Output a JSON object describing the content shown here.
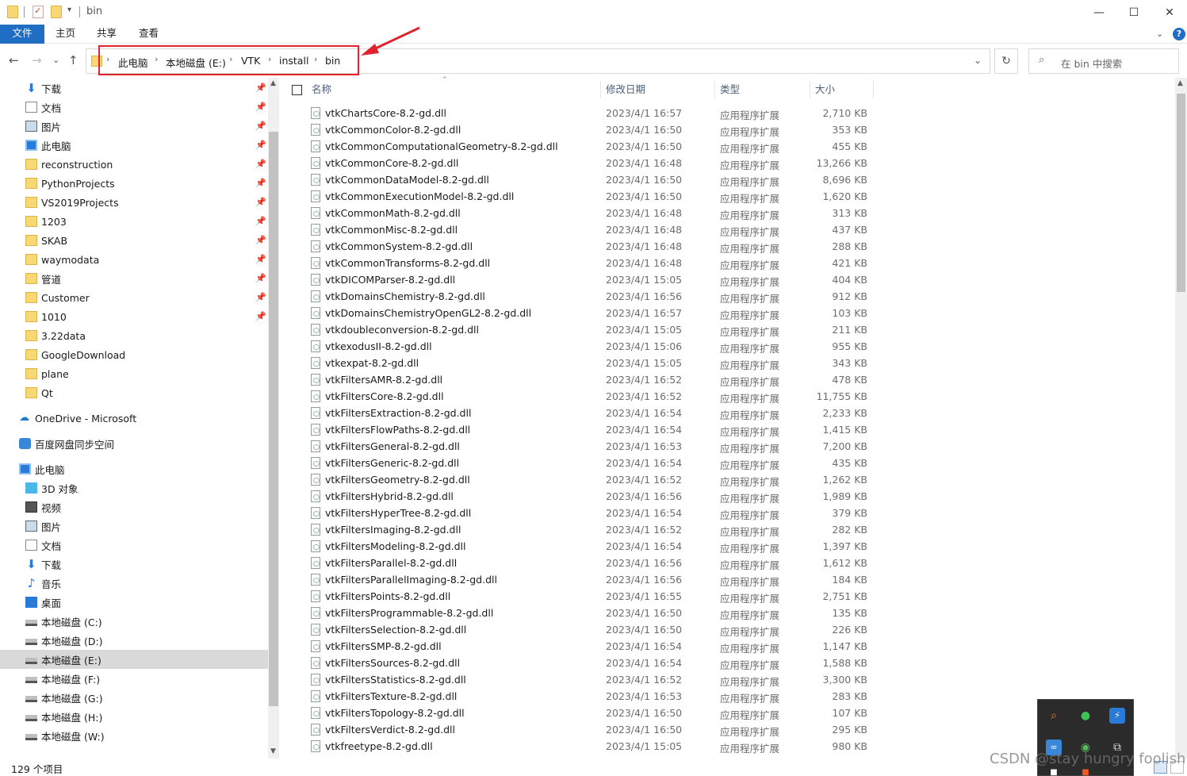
{
  "window": {
    "title": "bin",
    "minimize": "—",
    "maximize": "☐",
    "close": "✕"
  },
  "ribbon": {
    "tabs": [
      "文件",
      "主页",
      "共享",
      "查看"
    ],
    "expand": "⌄",
    "help": "?"
  },
  "nav": {
    "back": "←",
    "forward": "→",
    "recent": "⌄",
    "up": "↑",
    "breadcrumb": [
      "此电脑",
      "本地磁盘 (E:)",
      "VTK",
      "install",
      "bin"
    ],
    "refresh": "↻",
    "search_placeholder": "在 bin 中搜索"
  },
  "sidebar": {
    "quick_access": [
      {
        "label": "下载",
        "icon": "download-icon",
        "pinned": true
      },
      {
        "label": "文档",
        "icon": "document-icon",
        "pinned": true
      },
      {
        "label": "图片",
        "icon": "pictures-icon",
        "pinned": true
      },
      {
        "label": "此电脑",
        "icon": "computer-icon",
        "pinned": true
      },
      {
        "label": "reconstruction",
        "icon": "folder-icon",
        "pinned": true
      },
      {
        "label": "PythonProjects",
        "icon": "folder-icon",
        "pinned": true
      },
      {
        "label": "VS2019Projects",
        "icon": "folder-icon",
        "pinned": true
      },
      {
        "label": "1203",
        "icon": "folder-icon",
        "pinned": true
      },
      {
        "label": "SKAB",
        "icon": "folder-icon",
        "pinned": true
      },
      {
        "label": "waymodata",
        "icon": "folder-icon",
        "pinned": true
      },
      {
        "label": "管道",
        "icon": "folder-icon",
        "pinned": true
      },
      {
        "label": "Customer",
        "icon": "folder-icon",
        "pinned": true
      },
      {
        "label": "1010",
        "icon": "folder-icon",
        "pinned": true
      },
      {
        "label": "3.22data",
        "icon": "folder-icon",
        "pinned": false
      },
      {
        "label": "GoogleDownload",
        "icon": "folder-icon",
        "pinned": false
      },
      {
        "label": "plane",
        "icon": "folder-icon",
        "pinned": false
      },
      {
        "label": "Qt",
        "icon": "folder-icon",
        "pinned": false
      }
    ],
    "onedrive": "OneDrive - Microsoft",
    "baidu": "百度网盘同步空间",
    "this_pc": "此电脑",
    "pc_items": [
      {
        "label": "3D 对象",
        "icon": "3d-objects-icon"
      },
      {
        "label": "视频",
        "icon": "video-icon"
      },
      {
        "label": "图片",
        "icon": "pictures-icon"
      },
      {
        "label": "文档",
        "icon": "document-icon"
      },
      {
        "label": "下载",
        "icon": "download-icon"
      },
      {
        "label": "音乐",
        "icon": "music-icon"
      },
      {
        "label": "桌面",
        "icon": "desktop-icon"
      },
      {
        "label": "本地磁盘 (C:)",
        "icon": "system-drive-icon"
      },
      {
        "label": "本地磁盘 (D:)",
        "icon": "drive-icon"
      },
      {
        "label": "本地磁盘 (E:)",
        "icon": "drive-icon",
        "selected": true
      },
      {
        "label": "本地磁盘 (F:)",
        "icon": "drive-icon"
      },
      {
        "label": "本地磁盘 (G:)",
        "icon": "drive-icon"
      },
      {
        "label": "本地磁盘 (H:)",
        "icon": "drive-icon"
      },
      {
        "label": "本地磁盘 (W:)",
        "icon": "drive-icon"
      }
    ]
  },
  "columns": {
    "name": "名称",
    "date": "修改日期",
    "type": "类型",
    "size": "大小"
  },
  "files": [
    {
      "name": "vtkChartsCore-8.2-gd.dll",
      "date": "2023/4/1 16:57",
      "type": "应用程序扩展",
      "size": "2,710 KB"
    },
    {
      "name": "vtkCommonColor-8.2-gd.dll",
      "date": "2023/4/1 16:50",
      "type": "应用程序扩展",
      "size": "353 KB"
    },
    {
      "name": "vtkCommonComputationalGeometry-8.2-gd.dll",
      "date": "2023/4/1 16:50",
      "type": "应用程序扩展",
      "size": "455 KB"
    },
    {
      "name": "vtkCommonCore-8.2-gd.dll",
      "date": "2023/4/1 16:48",
      "type": "应用程序扩展",
      "size": "13,266 KB"
    },
    {
      "name": "vtkCommonDataModel-8.2-gd.dll",
      "date": "2023/4/1 16:50",
      "type": "应用程序扩展",
      "size": "8,696 KB"
    },
    {
      "name": "vtkCommonExecutionModel-8.2-gd.dll",
      "date": "2023/4/1 16:50",
      "type": "应用程序扩展",
      "size": "1,620 KB"
    },
    {
      "name": "vtkCommonMath-8.2-gd.dll",
      "date": "2023/4/1 16:48",
      "type": "应用程序扩展",
      "size": "313 KB"
    },
    {
      "name": "vtkCommonMisc-8.2-gd.dll",
      "date": "2023/4/1 16:48",
      "type": "应用程序扩展",
      "size": "437 KB"
    },
    {
      "name": "vtkCommonSystem-8.2-gd.dll",
      "date": "2023/4/1 16:48",
      "type": "应用程序扩展",
      "size": "288 KB"
    },
    {
      "name": "vtkCommonTransforms-8.2-gd.dll",
      "date": "2023/4/1 16:48",
      "type": "应用程序扩展",
      "size": "421 KB"
    },
    {
      "name": "vtkDICOMParser-8.2-gd.dll",
      "date": "2023/4/1 15:05",
      "type": "应用程序扩展",
      "size": "404 KB"
    },
    {
      "name": "vtkDomainsChemistry-8.2-gd.dll",
      "date": "2023/4/1 16:56",
      "type": "应用程序扩展",
      "size": "912 KB"
    },
    {
      "name": "vtkDomainsChemistryOpenGL2-8.2-gd.dll",
      "date": "2023/4/1 16:57",
      "type": "应用程序扩展",
      "size": "103 KB"
    },
    {
      "name": "vtkdoubleconversion-8.2-gd.dll",
      "date": "2023/4/1 15:05",
      "type": "应用程序扩展",
      "size": "211 KB"
    },
    {
      "name": "vtkexodusII-8.2-gd.dll",
      "date": "2023/4/1 15:06",
      "type": "应用程序扩展",
      "size": "955 KB"
    },
    {
      "name": "vtkexpat-8.2-gd.dll",
      "date": "2023/4/1 15:05",
      "type": "应用程序扩展",
      "size": "343 KB"
    },
    {
      "name": "vtkFiltersAMR-8.2-gd.dll",
      "date": "2023/4/1 16:52",
      "type": "应用程序扩展",
      "size": "478 KB"
    },
    {
      "name": "vtkFiltersCore-8.2-gd.dll",
      "date": "2023/4/1 16:52",
      "type": "应用程序扩展",
      "size": "11,755 KB"
    },
    {
      "name": "vtkFiltersExtraction-8.2-gd.dll",
      "date": "2023/4/1 16:54",
      "type": "应用程序扩展",
      "size": "2,233 KB"
    },
    {
      "name": "vtkFiltersFlowPaths-8.2-gd.dll",
      "date": "2023/4/1 16:54",
      "type": "应用程序扩展",
      "size": "1,415 KB"
    },
    {
      "name": "vtkFiltersGeneral-8.2-gd.dll",
      "date": "2023/4/1 16:53",
      "type": "应用程序扩展",
      "size": "7,200 KB"
    },
    {
      "name": "vtkFiltersGeneric-8.2-gd.dll",
      "date": "2023/4/1 16:54",
      "type": "应用程序扩展",
      "size": "435 KB"
    },
    {
      "name": "vtkFiltersGeometry-8.2-gd.dll",
      "date": "2023/4/1 16:52",
      "type": "应用程序扩展",
      "size": "1,262 KB"
    },
    {
      "name": "vtkFiltersHybrid-8.2-gd.dll",
      "date": "2023/4/1 16:56",
      "type": "应用程序扩展",
      "size": "1,989 KB"
    },
    {
      "name": "vtkFiltersHyperTree-8.2-gd.dll",
      "date": "2023/4/1 16:54",
      "type": "应用程序扩展",
      "size": "379 KB"
    },
    {
      "name": "vtkFiltersImaging-8.2-gd.dll",
      "date": "2023/4/1 16:52",
      "type": "应用程序扩展",
      "size": "282 KB"
    },
    {
      "name": "vtkFiltersModeling-8.2-gd.dll",
      "date": "2023/4/1 16:54",
      "type": "应用程序扩展",
      "size": "1,397 KB"
    },
    {
      "name": "vtkFiltersParallel-8.2-gd.dll",
      "date": "2023/4/1 16:56",
      "type": "应用程序扩展",
      "size": "1,612 KB"
    },
    {
      "name": "vtkFiltersParallelImaging-8.2-gd.dll",
      "date": "2023/4/1 16:56",
      "type": "应用程序扩展",
      "size": "184 KB"
    },
    {
      "name": "vtkFiltersPoints-8.2-gd.dll",
      "date": "2023/4/1 16:55",
      "type": "应用程序扩展",
      "size": "2,751 KB"
    },
    {
      "name": "vtkFiltersProgrammable-8.2-gd.dll",
      "date": "2023/4/1 16:50",
      "type": "应用程序扩展",
      "size": "135 KB"
    },
    {
      "name": "vtkFiltersSelection-8.2-gd.dll",
      "date": "2023/4/1 16:50",
      "type": "应用程序扩展",
      "size": "226 KB"
    },
    {
      "name": "vtkFiltersSMP-8.2-gd.dll",
      "date": "2023/4/1 16:54",
      "type": "应用程序扩展",
      "size": "1,147 KB"
    },
    {
      "name": "vtkFiltersSources-8.2-gd.dll",
      "date": "2023/4/1 16:54",
      "type": "应用程序扩展",
      "size": "1,588 KB"
    },
    {
      "name": "vtkFiltersStatistics-8.2-gd.dll",
      "date": "2023/4/1 16:52",
      "type": "应用程序扩展",
      "size": "3,300 KB"
    },
    {
      "name": "vtkFiltersTexture-8.2-gd.dll",
      "date": "2023/4/1 16:53",
      "type": "应用程序扩展",
      "size": "283 KB"
    },
    {
      "name": "vtkFiltersTopology-8.2-gd.dll",
      "date": "2023/4/1 16:50",
      "type": "应用程序扩展",
      "size": "107 KB"
    },
    {
      "name": "vtkFiltersVerdict-8.2-gd.dll",
      "date": "2023/4/1 16:50",
      "type": "应用程序扩展",
      "size": "295 KB"
    },
    {
      "name": "vtkfreetype-8.2-gd.dll",
      "date": "2023/4/1 15:05",
      "type": "应用程序扩展",
      "size": "980 KB"
    }
  ],
  "status": {
    "item_count": "129 个项目"
  },
  "watermark": "CSDN @stay hungry foolish",
  "colors": {
    "accent": "#1f6ec4",
    "annotation": "#e0232f",
    "selected": "#d9d9d9"
  }
}
